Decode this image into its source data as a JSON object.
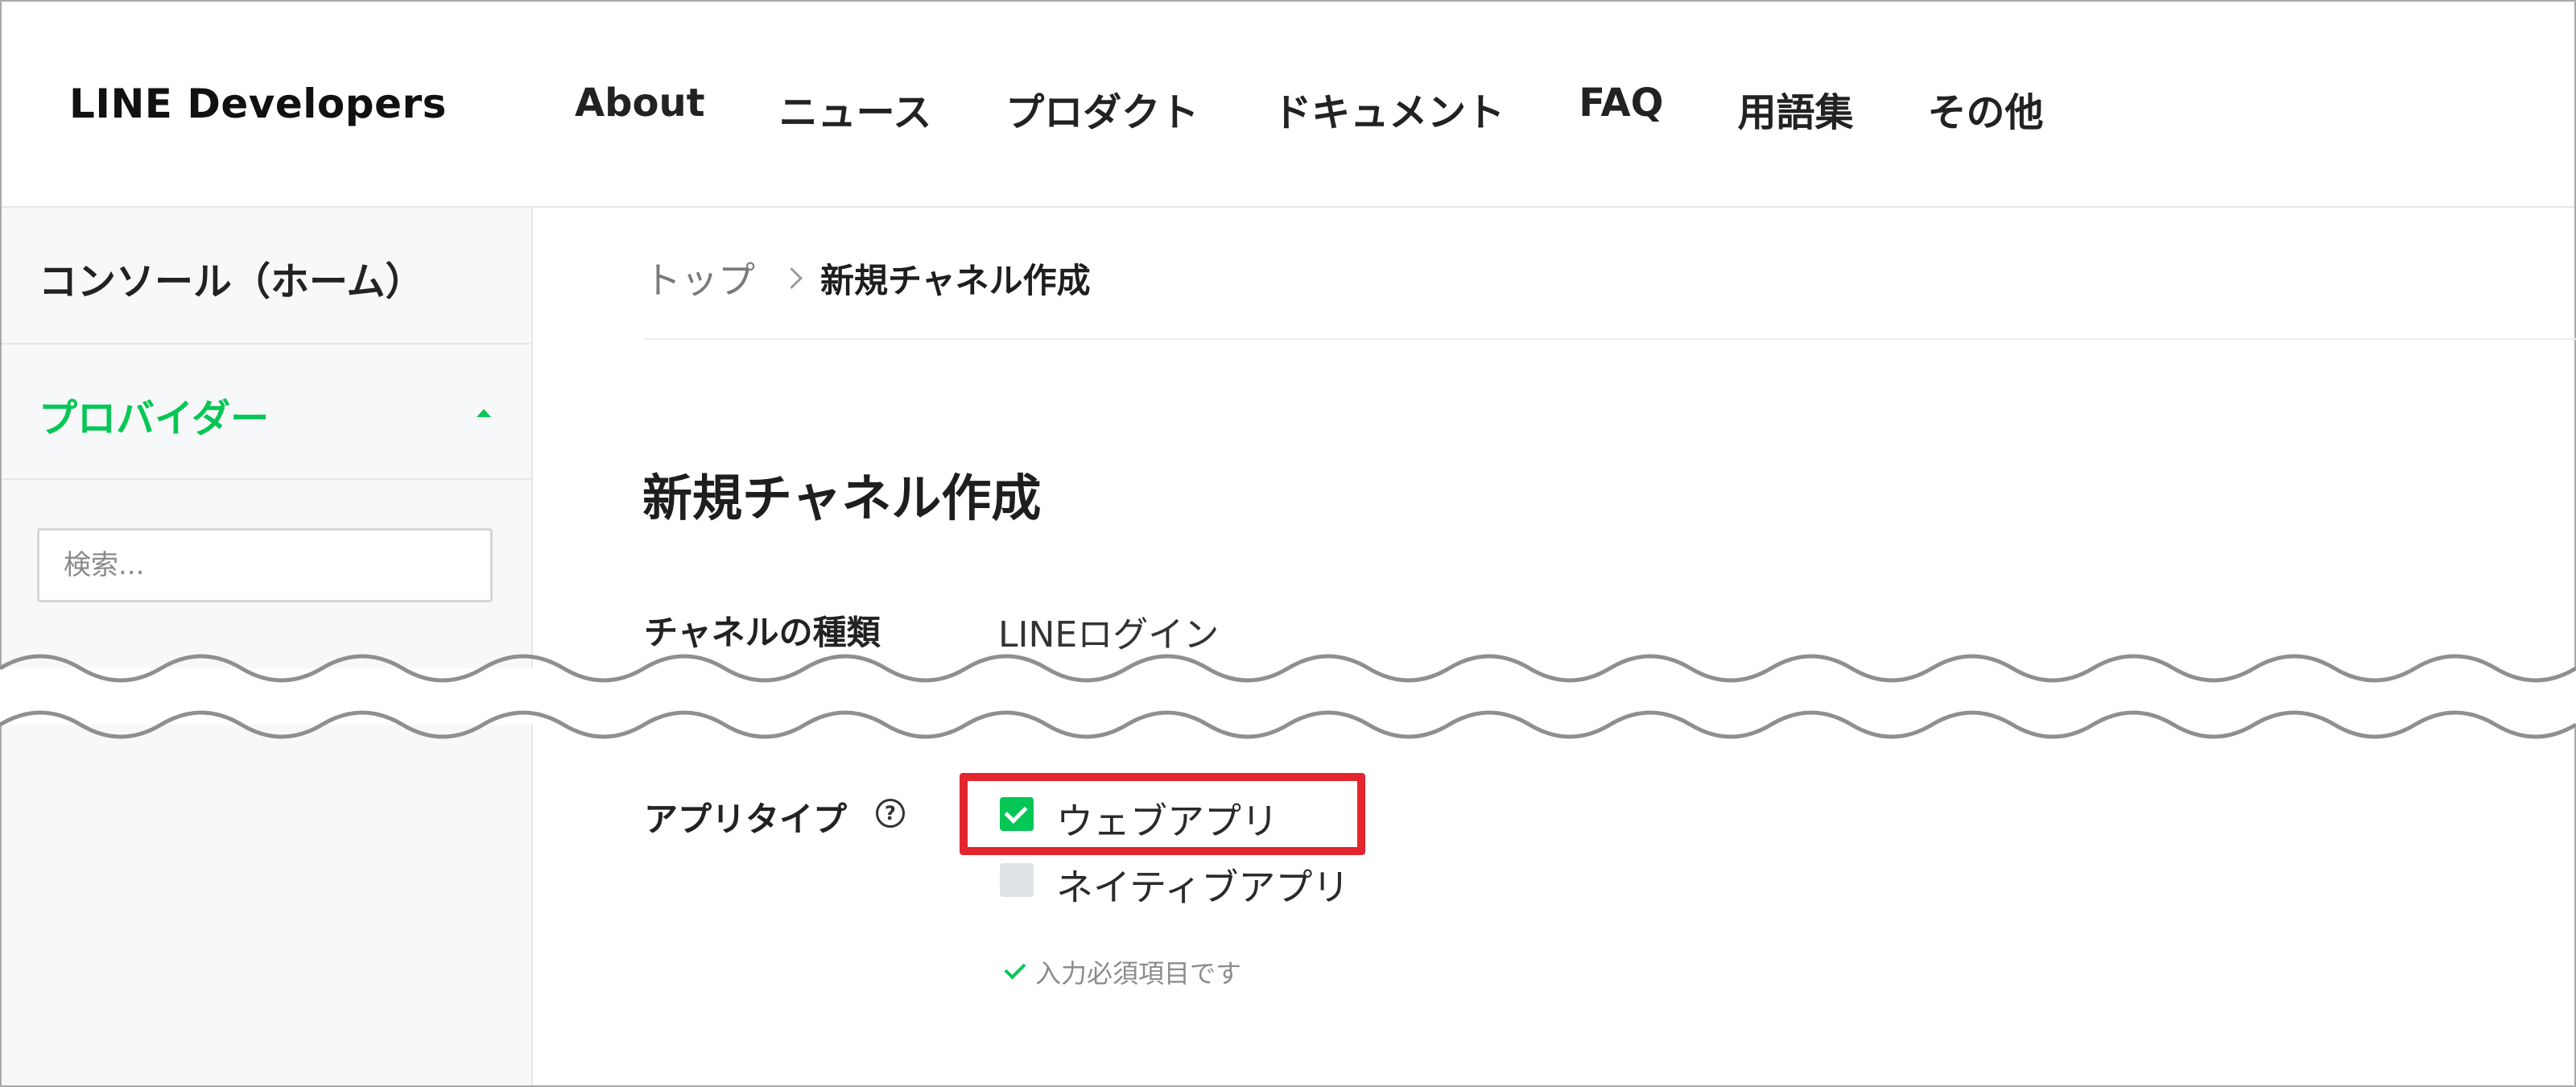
{
  "header": {
    "logo": "LINE Developers",
    "nav": [
      "About",
      "ニュース",
      "プロダクト",
      "ドキュメント",
      "FAQ",
      "用語集",
      "その他"
    ]
  },
  "sidebar": {
    "home": "コンソール（ホーム）",
    "provider": "プロバイダー",
    "search_placeholder": "検索..."
  },
  "breadcrumb": {
    "top": "トップ",
    "current": "新規チャネル作成"
  },
  "page": {
    "title": "新規チャネル作成",
    "channel_type_label": "チャネルの種類",
    "channel_type_value": "LINEログイン",
    "app_type_label": "アプリタイプ",
    "app_type_help": "?",
    "options": [
      {
        "label": "ウェブアプリ",
        "checked": true
      },
      {
        "label": "ネイティブアプリ",
        "checked": false
      }
    ],
    "required_note": "入力必須項目です"
  },
  "colors": {
    "accent": "#06c755",
    "highlight": "#e4252f"
  }
}
